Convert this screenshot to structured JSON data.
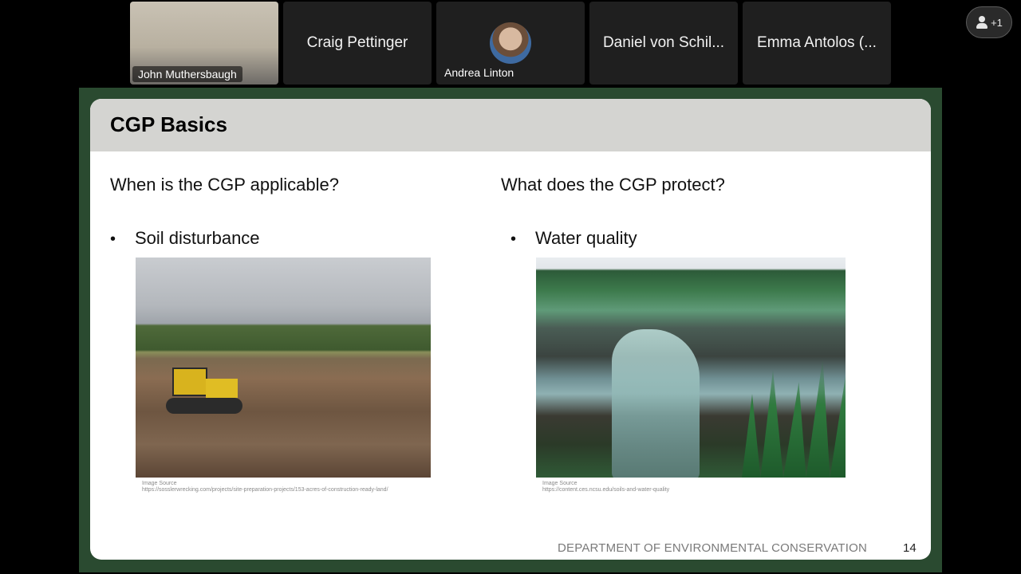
{
  "participants": [
    {
      "name": "John Muthersbaugh",
      "type": "video"
    },
    {
      "name": "Craig Pettinger",
      "type": "name"
    },
    {
      "name": "Andrea Linton",
      "type": "avatar"
    },
    {
      "name": "Daniel von Schil...",
      "type": "name"
    },
    {
      "name": "Emma Antolos (...",
      "type": "name"
    }
  ],
  "people_button": {
    "label": "+1",
    "icon": "person-icon"
  },
  "slide": {
    "title": "CGP Basics",
    "left": {
      "heading": "When is the CGP applicable?",
      "bullet": "Soil disturbance",
      "image_source_label": "Image Source",
      "image_source_url": "https://sosslerwrecking.com/projects/site-preparation-projects/153-acres-of-construction-ready-land/"
    },
    "right": {
      "heading": "What does the CGP protect?",
      "bullet": "Water quality",
      "image_source_label": "Image Source",
      "image_source_url": "https://content.ces.ncsu.edu/soils-and-water-quality"
    },
    "footer": "DEPARTMENT OF ENVIRONMENTAL CONSERVATION",
    "page_number": "14"
  },
  "colors": {
    "frame": "#2a4a30",
    "header_band": "#d4d4d1"
  }
}
